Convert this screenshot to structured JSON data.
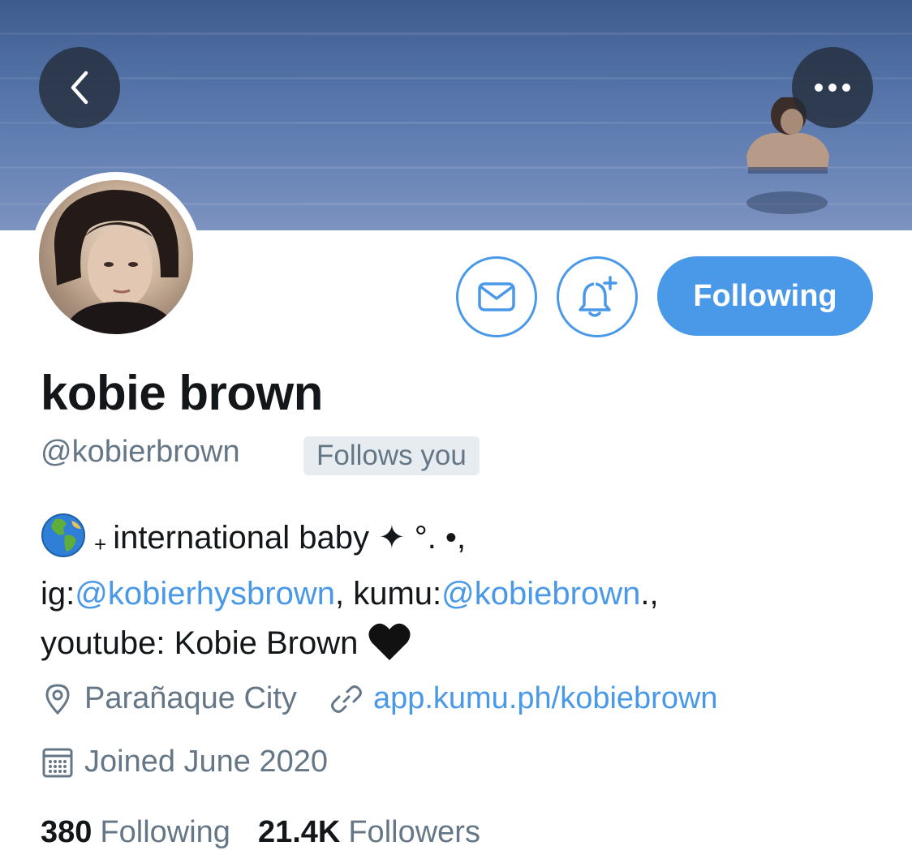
{
  "profile": {
    "display_name": "kobie brown",
    "handle": "@kobierbrown",
    "follows_you": "Follows you",
    "follow_button": "Following"
  },
  "bio": {
    "line1_text": "international baby ✦ °. •,",
    "line2_prefix": "ig:",
    "ig_link": "@kobierhysbrown",
    "line2_mid": ", kumu:",
    "kumu_link": "@kobiebrown",
    "line2_suffix": ".,",
    "line3_text": "youtube: Kobie Brown "
  },
  "meta": {
    "location": "Parañaque City",
    "website": "app.kumu.ph/kobiebrown",
    "joined": "Joined June 2020"
  },
  "stats": {
    "following_count": "380",
    "following_label": "Following",
    "followers_count": "21.4K",
    "followers_label": "Followers"
  },
  "icons": {
    "back": "chevron-left-icon",
    "more": "more-horizontal-icon",
    "message": "envelope-icon",
    "notify": "bell-plus-icon",
    "location": "map-pin-icon",
    "website": "link-icon",
    "joined": "calendar-icon",
    "globe": "globe-emoji",
    "heart": "black-heart-emoji"
  },
  "colors": {
    "accent": "#4a99e9",
    "secondary_text": "#657786",
    "primary_text": "#14171a",
    "badge_bg": "#e6ecf0"
  }
}
